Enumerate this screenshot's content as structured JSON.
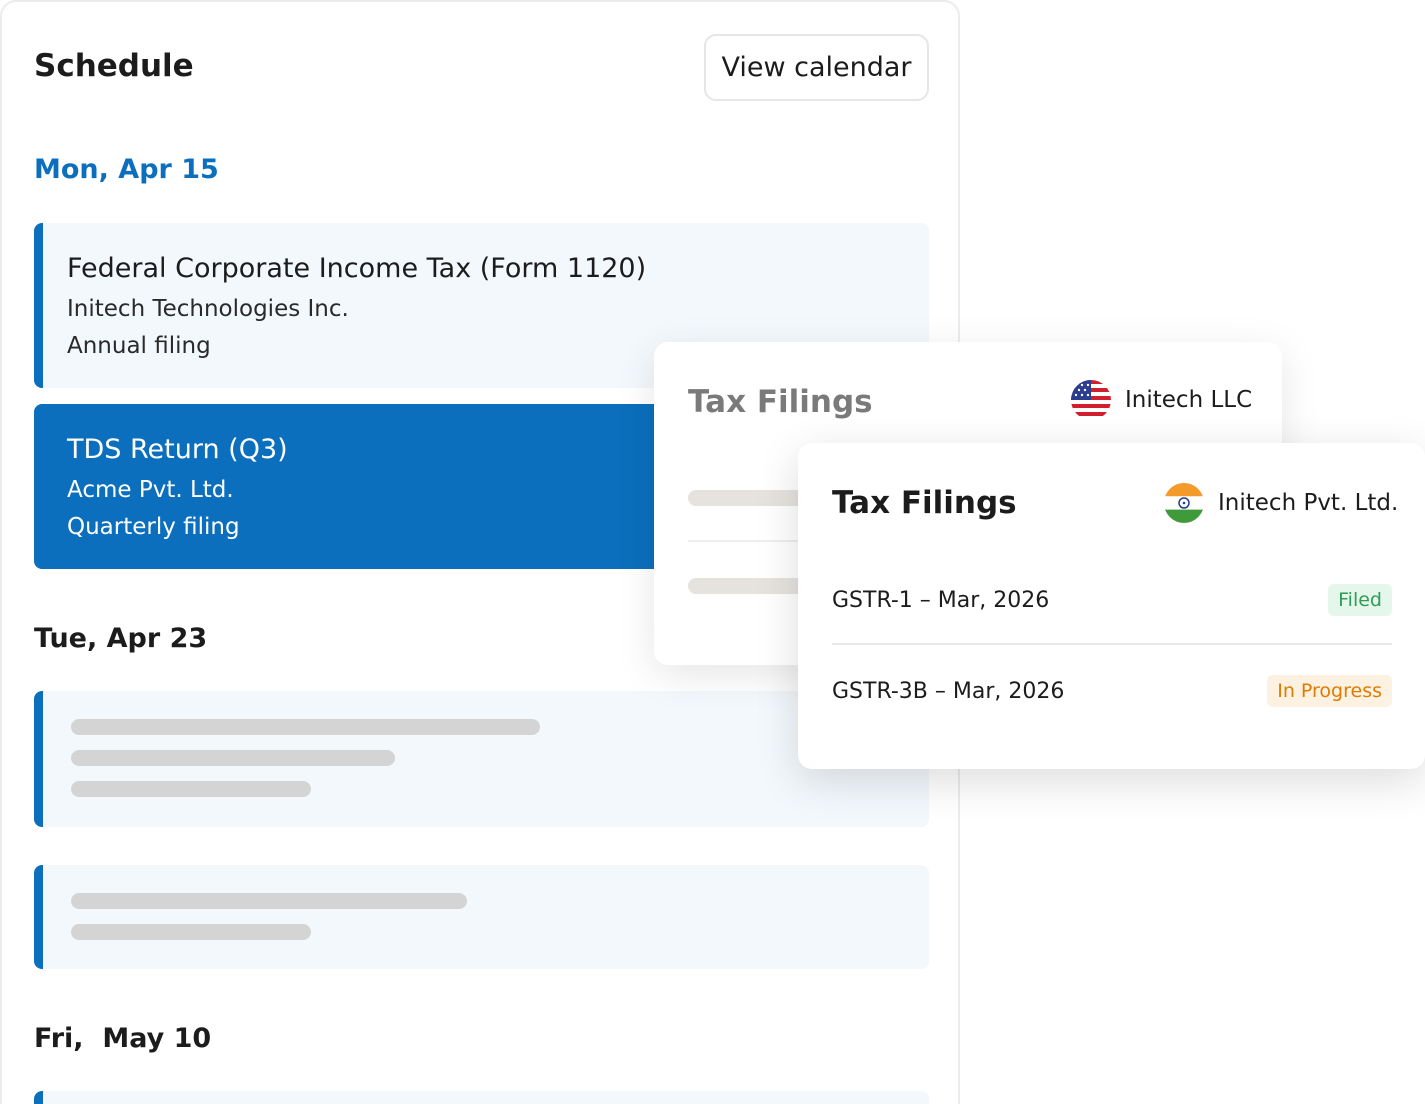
{
  "schedule": {
    "title": "Schedule",
    "view_calendar_label": "View calendar",
    "days": [
      {
        "date": "Mon, Apr 15",
        "events": [
          {
            "title": "Federal Corporate Income Tax (Form 1120)",
            "company": "Initech Technologies Inc.",
            "frequency": "Annual filing"
          },
          {
            "title": "TDS Return (Q3)",
            "company": "Acme Pvt. Ltd.",
            "frequency": "Quarterly filing"
          }
        ]
      },
      {
        "date": "Tue, Apr 23"
      },
      {
        "date": "Fri,  May 10"
      }
    ]
  },
  "popovers": {
    "back": {
      "title": "Tax Filings",
      "entity": "Initech LLC",
      "flag_icon": "us-flag-icon"
    },
    "front": {
      "title": "Tax Filings",
      "entity": "Initech Pvt. Ltd.",
      "flag_icon": "india-flag-icon",
      "filings": [
        {
          "name": "GSTR-1 – Mar, 2026",
          "status": "Filed"
        },
        {
          "name": "GSTR-3B – Mar, 2026",
          "status": "In Progress"
        }
      ]
    }
  },
  "colors": {
    "accent": "#0b6fbd",
    "card_bg": "#f3f8fd",
    "filed_text": "#2f9d56",
    "filed_bg": "#e5f6ea",
    "progress_text": "#e07b00",
    "progress_bg": "#fdf2e1"
  }
}
